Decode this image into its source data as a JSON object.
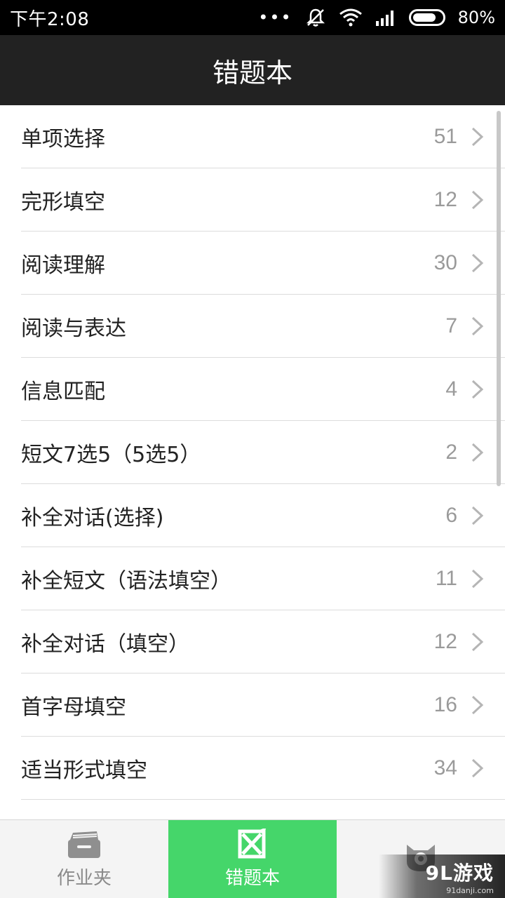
{
  "status": {
    "time": "下午2:08",
    "battery": "80%",
    "battery_level": 0.8
  },
  "title": "错题本",
  "list": {
    "items": [
      {
        "label": "单项选择",
        "count": "51"
      },
      {
        "label": "完形填空",
        "count": "12"
      },
      {
        "label": "阅读理解",
        "count": "30"
      },
      {
        "label": "阅读与表达",
        "count": "7"
      },
      {
        "label": "信息匹配",
        "count": "4"
      },
      {
        "label": "短文7选5（5选5）",
        "count": "2"
      },
      {
        "label": "补全对话(选择)",
        "count": "6"
      },
      {
        "label": "补全短文（语法填空）",
        "count": "11"
      },
      {
        "label": "补全对话（填空）",
        "count": "12"
      },
      {
        "label": "首字母填空",
        "count": "16"
      },
      {
        "label": "适当形式填空",
        "count": "34"
      }
    ]
  },
  "tabs": [
    {
      "label": "作业夹",
      "icon": "folder-icon",
      "active": false
    },
    {
      "label": "错题本",
      "icon": "wrong-book-icon",
      "active": true
    },
    {
      "label": "",
      "icon": "monster-icon",
      "active": false
    }
  ],
  "watermark": {
    "main": "9L游戏",
    "sub": "91danji.com"
  },
  "colors": {
    "accent": "#45d66a",
    "title_bar": "#222222",
    "status_bar": "#000000"
  }
}
